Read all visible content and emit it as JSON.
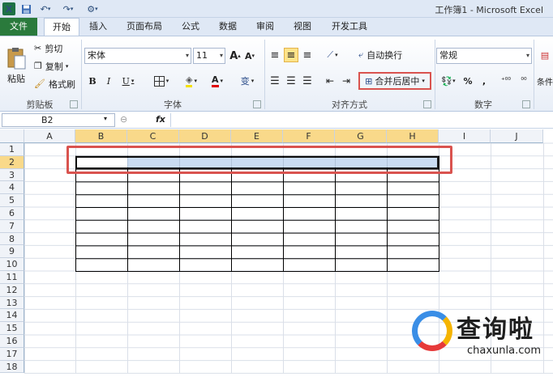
{
  "window": {
    "title": "工作簿1 - Microsoft Excel",
    "logo": "X"
  },
  "quick_access": {
    "save": "save-icon",
    "undo": "undo-icon",
    "redo": "redo-icon"
  },
  "tabs": [
    {
      "label": "文件",
      "active": false
    },
    {
      "label": "开始",
      "active": true
    },
    {
      "label": "插入"
    },
    {
      "label": "页面布局"
    },
    {
      "label": "公式"
    },
    {
      "label": "数据"
    },
    {
      "label": "审阅"
    },
    {
      "label": "视图"
    },
    {
      "label": "开发工具"
    }
  ],
  "clipboard": {
    "paste": "粘贴",
    "cut": "剪切",
    "copy": "复制",
    "format_painter": "格式刷",
    "group": "剪贴板"
  },
  "font": {
    "name": "宋体",
    "size": "11",
    "bold": "B",
    "italic": "I",
    "underline": "U",
    "group": "字体",
    "grow": "A",
    "shrink": "A",
    "text_color": "A",
    "phonetic": "变"
  },
  "alignment": {
    "wrap": "自动换行",
    "merge": "合并后居中",
    "group": "对齐方式"
  },
  "number": {
    "format": "常规",
    "percent": "%",
    "comma": ",",
    "group": "数字"
  },
  "styles": {
    "conditional": "条件"
  },
  "formula_bar": {
    "name_box": "B2",
    "fx": "fx"
  },
  "columns": [
    "A",
    "B",
    "C",
    "D",
    "E",
    "F",
    "G",
    "H",
    "I",
    "J"
  ],
  "rows": [
    "1",
    "2",
    "3",
    "4",
    "5",
    "6",
    "7",
    "8",
    "9",
    "10",
    "11",
    "12",
    "13",
    "14",
    "15",
    "16",
    "17",
    "18"
  ],
  "selected_cell": "B2",
  "selected_range": "B2:H2",
  "colors": {
    "selection": "#c5d9f1",
    "highlight": "#d9534f",
    "header_selected": "#f9d98a",
    "file_tab": "#2a7a3c"
  },
  "watermark": {
    "text": "查询啦",
    "domain": "chaxunla.com"
  }
}
